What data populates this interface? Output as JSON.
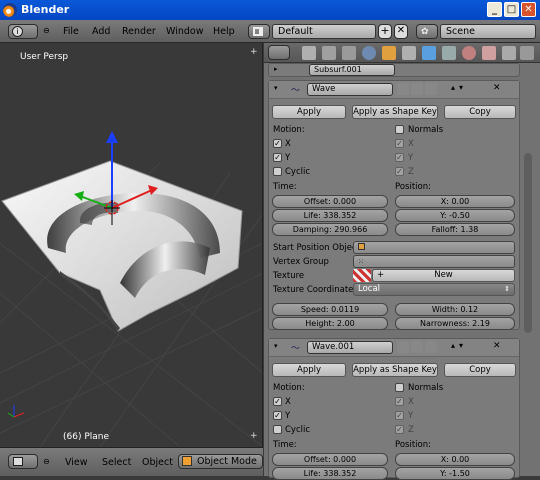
{
  "window": {
    "title": "Blender",
    "min": "_",
    "max": "□",
    "close": "✕"
  },
  "menu": {
    "items": [
      "File",
      "Add",
      "Render",
      "Window",
      "Help"
    ],
    "layout": "Default",
    "scene": "Scene"
  },
  "viewport": {
    "label": "User Persp",
    "object_label": "(66) Plane"
  },
  "viewport_header": {
    "view": "View",
    "select": "Select",
    "object": "Object",
    "mode": "Object Mode"
  },
  "props": {
    "top_modifier": "Subsurf.001",
    "wave": {
      "name": "Wave",
      "apply": "Apply",
      "apply_shape": "Apply as Shape Key",
      "copy": "Copy",
      "motion": "Motion:",
      "x": "X",
      "y": "Y",
      "cyclic": "Cyclic",
      "normals": "Normals",
      "nx": "X",
      "ny": "Y",
      "nz": "Z",
      "time": "Time:",
      "position": "Position:",
      "offset": "Offset: 0.000",
      "life": "Life: 338.352",
      "damping": "Damping: 290.966",
      "pos_x": "X: 0.00",
      "pos_y": "Y: -0.50",
      "falloff": "Falloff: 1.38",
      "start_position_object": "Start Position Object:",
      "vertex_group": "Vertex Group",
      "texture": "Texture",
      "texture_new": "New",
      "texture_coords_label": "Texture Coordinates:",
      "texture_coords_value": "Local",
      "speed": "Speed: 0.0119",
      "width": "Width: 0.12",
      "height": "Height: 2.00",
      "narrowness": "Narrowness: 2.19"
    },
    "wave2": {
      "name": "Wave.001",
      "apply": "Apply",
      "apply_shape": "Apply as Shape Key",
      "copy": "Copy",
      "motion": "Motion:",
      "x": "X",
      "y": "Y",
      "cyclic": "Cyclic",
      "normals": "Normals",
      "nx": "X",
      "ny": "Y",
      "nz": "Z",
      "time": "Time:",
      "position": "Position:",
      "offset": "Offset: 0.000",
      "life": "Life: 338.352",
      "pos_x": "X: 0.00",
      "pos_y": "Y: -1.50"
    }
  }
}
